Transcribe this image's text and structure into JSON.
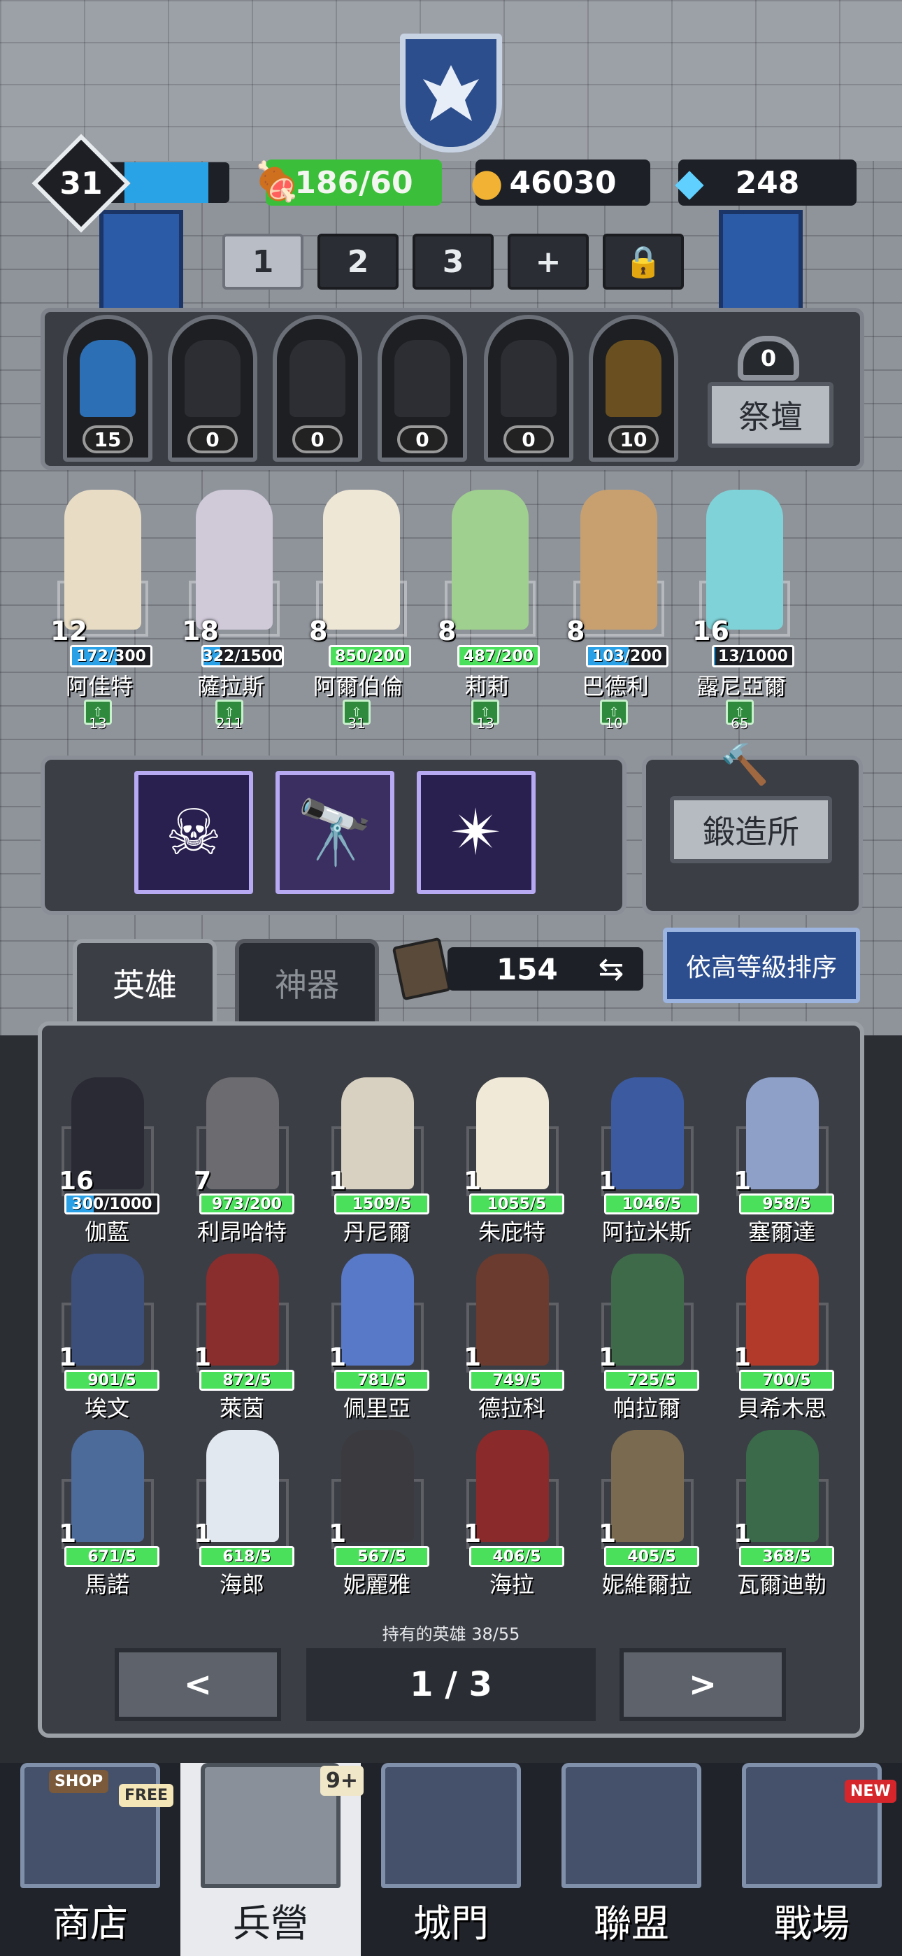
{
  "player": {
    "level": "31",
    "xp_fraction": 0.8
  },
  "resources": {
    "stamina": "186/60",
    "gold": "46030",
    "gems": "248"
  },
  "team_tabs": [
    "1",
    "2",
    "3",
    "+"
  ],
  "altar": {
    "slots": [
      "15",
      "0",
      "0",
      "0",
      "0",
      "10"
    ],
    "counter": "0",
    "button": "祭壇"
  },
  "formation": [
    {
      "level": "12",
      "hp": "172/300",
      "name": "阿佳特",
      "power": "13",
      "hp_fraction": 0.57,
      "color": "#e8dcc4"
    },
    {
      "level": "18",
      "hp": "322/1500",
      "name": "薩拉斯",
      "power": "211",
      "hp_fraction": 0.21,
      "color": "#cfc9d8"
    },
    {
      "level": "8",
      "hp": "850/200",
      "name": "阿爾伯倫",
      "power": "31",
      "hp_fraction": 1,
      "color": "#efe7d6"
    },
    {
      "level": "8",
      "hp": "487/200",
      "name": "莉莉",
      "power": "13",
      "hp_fraction": 1,
      "color": "#9fd08f"
    },
    {
      "level": "8",
      "hp": "103/200",
      "name": "巴德利",
      "power": "10",
      "hp_fraction": 0.52,
      "color": "#c8a070"
    },
    {
      "level": "16",
      "hp": "13/1000",
      "name": "露尼亞爾",
      "power": "65",
      "hp_fraction": 0.02,
      "color": "#7fd3d8"
    }
  ],
  "forge": {
    "button": "鍛造所"
  },
  "tabs": {
    "heroes": "英雄",
    "artifacts": "神器"
  },
  "book_count": "154",
  "sort_button": "依高等級排序",
  "roster": [
    {
      "level": "16",
      "hp": "300/1000",
      "name": "伽藍",
      "hp_fraction": 0.3,
      "color": "#2a2a35"
    },
    {
      "level": "7",
      "hp": "973/200",
      "name": "利昂哈特",
      "hp_fraction": 1,
      "color": "#6b6b70"
    },
    {
      "level": "1",
      "hp": "1509/5",
      "name": "丹尼爾",
      "hp_fraction": 1,
      "color": "#d8d0c0"
    },
    {
      "level": "1",
      "hp": "1055/5",
      "name": "朱庇特",
      "hp_fraction": 1,
      "color": "#f0e9d8"
    },
    {
      "level": "1",
      "hp": "1046/5",
      "name": "阿拉米斯",
      "hp_fraction": 1,
      "color": "#3b5aa0"
    },
    {
      "level": "1",
      "hp": "958/5",
      "name": "塞爾達",
      "hp_fraction": 1,
      "color": "#8ea0c8"
    },
    {
      "level": "1",
      "hp": "901/5",
      "name": "埃文",
      "hp_fraction": 1,
      "color": "#3c4f7a"
    },
    {
      "level": "1",
      "hp": "872/5",
      "name": "萊茵",
      "hp_fraction": 1,
      "color": "#8a2d2d"
    },
    {
      "level": "1",
      "hp": "781/5",
      "name": "佩里亞",
      "hp_fraction": 1,
      "color": "#5878c8"
    },
    {
      "level": "1",
      "hp": "749/5",
      "name": "德拉科",
      "hp_fraction": 1,
      "color": "#6a3b2e"
    },
    {
      "level": "1",
      "hp": "725/5",
      "name": "帕拉爾",
      "hp_fraction": 1,
      "color": "#3f6a4a"
    },
    {
      "level": "1",
      "hp": "700/5",
      "name": "貝希木思",
      "hp_fraction": 1,
      "color": "#b23a2a"
    },
    {
      "level": "1",
      "hp": "671/5",
      "name": "馬諾",
      "hp_fraction": 1,
      "color": "#4c6a9a"
    },
    {
      "level": "1",
      "hp": "618/5",
      "name": "海郎",
      "hp_fraction": 1,
      "color": "#e2e8f0"
    },
    {
      "level": "1",
      "hp": "567/5",
      "name": "妮麗雅",
      "hp_fraction": 1,
      "color": "#3a3a3f"
    },
    {
      "level": "1",
      "hp": "406/5",
      "name": "海拉",
      "hp_fraction": 1,
      "color": "#8a2a2a"
    },
    {
      "level": "1",
      "hp": "405/5",
      "name": "妮維爾拉",
      "hp_fraction": 1,
      "color": "#7a6a50"
    },
    {
      "level": "1",
      "hp": "368/5",
      "name": "瓦爾迪勒",
      "hp_fraction": 1,
      "color": "#3a6a4a"
    }
  ],
  "owned_text": "持有的英雄 38/55",
  "pagination": {
    "prev": "<",
    "page": "1 / 3",
    "next": ">"
  },
  "nav": [
    {
      "label": "商店",
      "badge": "FREE",
      "sign": "SHOP"
    },
    {
      "label": "兵營",
      "badge": "9+"
    },
    {
      "label": "城門"
    },
    {
      "label": "聯盟"
    },
    {
      "label": "戰場",
      "badge": "NEW"
    }
  ]
}
